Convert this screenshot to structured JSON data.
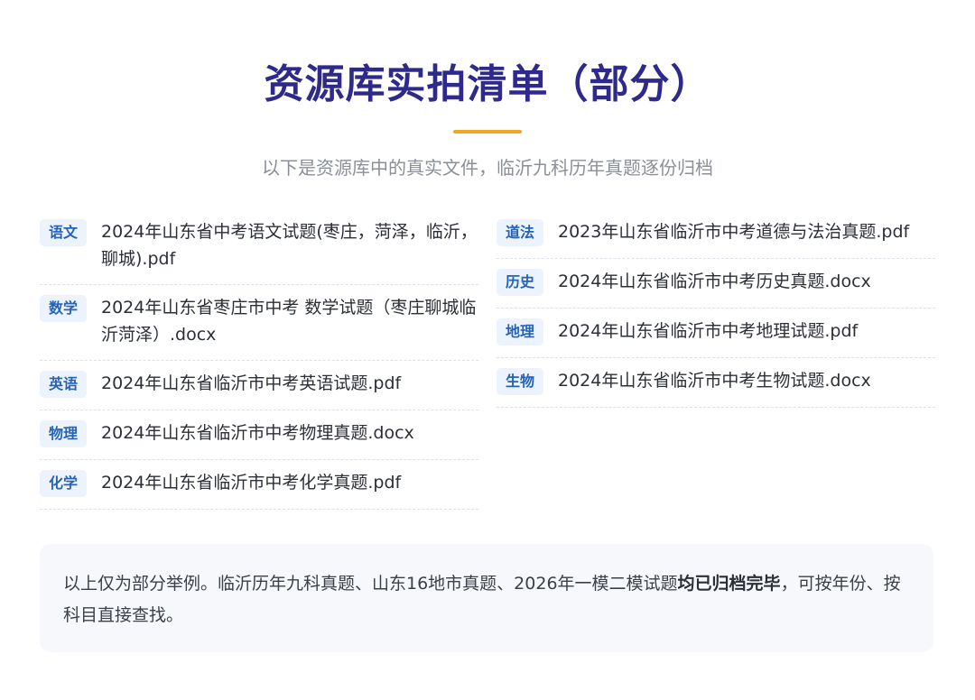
{
  "colors": {
    "title": "#2e2a8c",
    "accent_bar": "#f3a524",
    "tag_bg": "#edf3fc",
    "tag_text": "#2563b8"
  },
  "header": {
    "title": "资源库实拍清单（部分）",
    "subtitle": "以下是资源库中的真实文件，临沂九科历年真题逐份归档"
  },
  "left_items": [
    {
      "subject": "语文",
      "file": "2024年山东省中考语文试题(枣庄，菏泽，临沂，聊城).pdf"
    },
    {
      "subject": "数学",
      "file": "2024年山东省枣庄市中考 数学试题（枣庄聊城临沂菏泽）.docx"
    },
    {
      "subject": "英语",
      "file": "2024年山东省临沂市中考英语试题.pdf"
    },
    {
      "subject": "物理",
      "file": "2024年山东省临沂市中考物理真题.docx"
    },
    {
      "subject": "化学",
      "file": "2024年山东省临沂市中考化学真题.pdf"
    }
  ],
  "right_items": [
    {
      "subject": "道法",
      "file": "2023年山东省临沂市中考道德与法治真题.pdf"
    },
    {
      "subject": "历史",
      "file": "2024年山东省临沂市中考历史真题.docx"
    },
    {
      "subject": "地理",
      "file": "2024年山东省临沂市中考地理试题.pdf"
    },
    {
      "subject": "生物",
      "file": "2024年山东省临沂市中考生物试题.docx"
    }
  ],
  "note": {
    "text_before": "以上仅为部分举例。临沂历年九科真题、山东16地市真题、2026年一模二模试题",
    "text_bold": "均已归档完毕",
    "text_after": "，可按年份、按科目直接查找。"
  }
}
